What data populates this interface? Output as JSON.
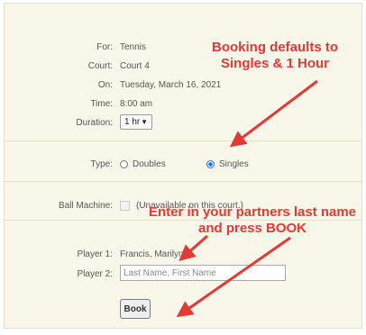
{
  "form": {
    "for_label": "For:",
    "for_value": "Tennis",
    "court_label": "Court:",
    "court_value": "Court 4",
    "on_label": "On:",
    "on_value": "Tuesday, March 16, 2021",
    "time_label": "Time:",
    "time_value": "8:00 am",
    "duration_label": "Duration:",
    "duration_value": "1 hr",
    "type_label": "Type:",
    "type_options": [
      "Doubles",
      "Singles"
    ],
    "type_selected": "Singles",
    "ball_machine_label": "Ball Machine:",
    "ball_machine_note": "(Unavailable on this court.)",
    "player1_label": "Player 1:",
    "player1_value": "Francis, Marilyn",
    "player2_label": "Player 2:",
    "player2_placeholder": "Last Name, First Name",
    "book_label": "Book"
  },
  "annotations": {
    "defaults_line1": "Booking defaults to",
    "defaults_line2": "Singles & 1 Hour",
    "partner_line1": "Enter in your partners last name",
    "partner_line2": "and press BOOK",
    "color": "#e53935"
  }
}
